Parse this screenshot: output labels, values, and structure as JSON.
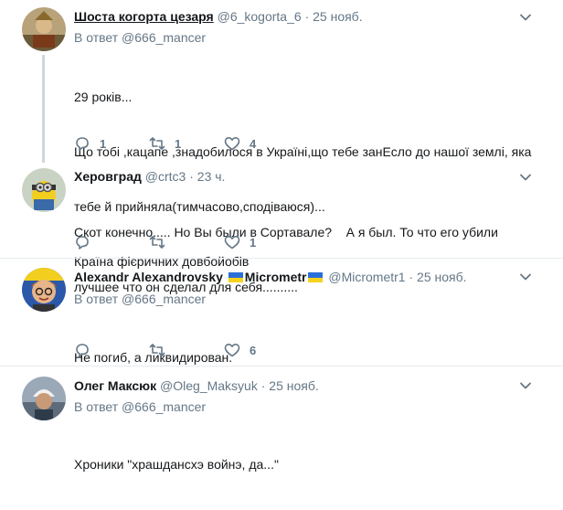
{
  "tweets": [
    {
      "name": "Шоста когорта цезаря",
      "handle": "@6_kogorta_6",
      "separator": "·",
      "time": "25 нояб.",
      "reply_prefix": "В ответ",
      "reply_mention": "@666_mancer",
      "text_lines": [
        "29 років...",
        "Що тобі ,кацапе ,знадобилося в Україні,що тебе занЕсло до нашої землі, яка",
        "тебе й прийняла(тимчасово,сподіваюся)...",
        "Країна фієричних довбойобів"
      ],
      "replies": "1",
      "retweets": "1",
      "likes": "4"
    },
    {
      "name": "Херовград",
      "handle": "@crtc3",
      "separator": "·",
      "time": "23 ч.",
      "text_lines": [
        "Скот конечно..... Но Вы были в Сортавале?    А я был. То что его убили",
        "лучшее что он сделал для себя.........."
      ],
      "replies": "",
      "retweets": "",
      "likes": "1"
    },
    {
      "name": "Alexandr Alexandrovsky",
      "name_suffix": "Micrometr",
      "handle": "@Micrometr1",
      "separator": "·",
      "time": "25 нояб.",
      "reply_prefix": "В ответ",
      "reply_mention": "@666_mancer",
      "text_lines": [
        "Не погиб, а ликвидирован."
      ],
      "replies": "",
      "retweets": "",
      "likes": "6"
    },
    {
      "name": "Олег Максюк",
      "handle": "@Oleg_Maksyuk",
      "separator": "·",
      "time": "25 нояб.",
      "reply_prefix": "В ответ",
      "reply_mention": "@666_mancer",
      "text_lines": [
        "Хроники \"храшдансхэ войнэ, да...\""
      ]
    }
  ],
  "icons": [
    "reply-icon",
    "retweet-icon",
    "like-icon",
    "caret-down-icon",
    "ukraine-flag-icon"
  ],
  "colors": {
    "text": "#14171a",
    "muted": "#657786",
    "divider": "#e6ecf0",
    "thread": "#ccd6dd",
    "flag_blue": "#2a6fd8",
    "flag_yellow": "#f7d21d"
  }
}
